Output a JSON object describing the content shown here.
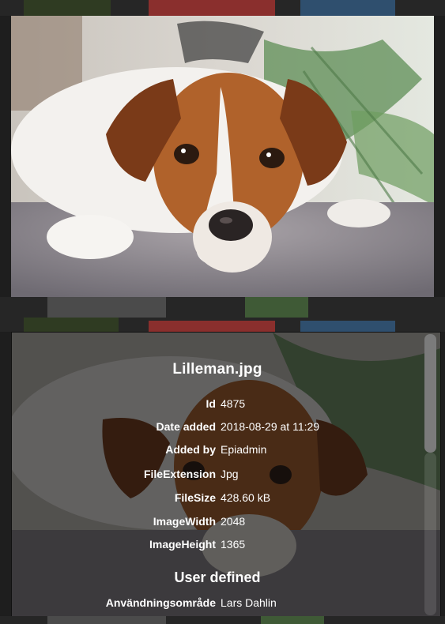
{
  "image": {
    "alt": "Lilleman.jpg"
  },
  "details": {
    "filename": "Lilleman.jpg",
    "fields": [
      {
        "key": "Id",
        "value": "4875"
      },
      {
        "key": "Date added",
        "value": "2018-08-29 at 11:29"
      },
      {
        "key": "Added by",
        "value": "Epiadmin"
      },
      {
        "key": "FileExtension",
        "value": "Jpg"
      },
      {
        "key": "FileSize",
        "value": "428.60 kB"
      },
      {
        "key": "ImageWidth",
        "value": "2048"
      },
      {
        "key": "ImageHeight",
        "value": "1365"
      }
    ],
    "user_defined_heading": "User defined",
    "user_defined": [
      {
        "key": "Användningsområde",
        "value": "Lars Dahlin"
      }
    ]
  },
  "colors": {
    "panel_text": "#ffffff",
    "background": "#1e1e1e",
    "scrollbar_thumb": "#7b7b7b"
  }
}
